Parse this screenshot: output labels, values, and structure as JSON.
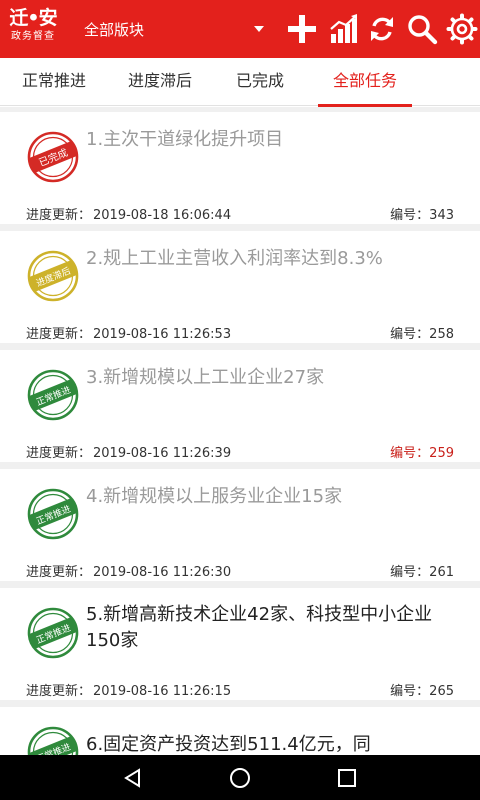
{
  "header": {
    "logo_main": "迁•安",
    "logo_sub": "政务督查",
    "section_select": "全部版块",
    "icons": [
      "plus-icon",
      "chart-icon",
      "refresh-icon",
      "search-icon",
      "gear-icon"
    ]
  },
  "tabs": [
    {
      "label": "正常推进"
    },
    {
      "label": "进度滞后"
    },
    {
      "label": "已完成"
    },
    {
      "label": "全部任务"
    }
  ],
  "active_tab": "全部任务",
  "list": {
    "update_label": "进度更新：",
    "number_label": "编号：",
    "items": [
      {
        "title": "1.主次干道绿化提升项目",
        "stamp": "已完成",
        "stamp_color": "#d42a25",
        "updated": "2019-08-18 16:06:44",
        "number": "343",
        "highlight": false,
        "title_dark": false
      },
      {
        "title": "2.规上工业主营收入利润率达到8.3%",
        "stamp": "进度滞后",
        "stamp_color": "#cdb22a",
        "updated": "2019-08-16 11:26:53",
        "number": "258",
        "highlight": false,
        "title_dark": false
      },
      {
        "title": "3.新增规模以上工业企业27家",
        "stamp": "正常推进",
        "stamp_color": "#2f8a3c",
        "updated": "2019-08-16 11:26:39",
        "number": "259",
        "highlight": true,
        "title_dark": false
      },
      {
        "title": "4.新增规模以上服务业企业15家",
        "stamp": "正常推进",
        "stamp_color": "#2f8a3c",
        "updated": "2019-08-16 11:26:30",
        "number": "261",
        "highlight": false,
        "title_dark": false
      },
      {
        "title": "5.新增高新技术企业42家、科技型中小企业150家",
        "stamp": "正常推进",
        "stamp_color": "#2f8a3c",
        "updated": "2019-08-16 11:26:15",
        "number": "265",
        "highlight": false,
        "title_dark": true
      },
      {
        "title": "6.固定资产投资达到511.4亿元，同",
        "stamp": "正常推进",
        "stamp_color": "#2f8a3c",
        "updated": "",
        "number": "",
        "highlight": false,
        "title_dark": true
      }
    ]
  },
  "colors": {
    "brand_red": "#e3211c",
    "done_red": "#d42a25",
    "lag_yellow": "#cdb22a",
    "normal_green": "#2f8a3c"
  },
  "navbar": {
    "icons": [
      "back-icon",
      "home-icon",
      "recents-icon"
    ]
  }
}
